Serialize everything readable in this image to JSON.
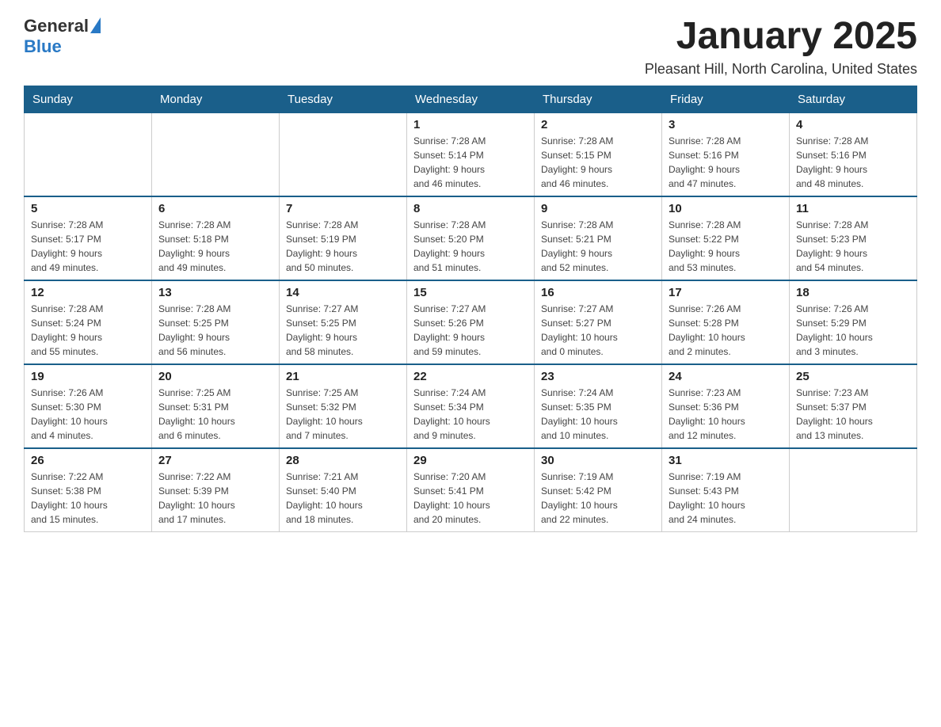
{
  "header": {
    "logo_general": "General",
    "logo_blue": "Blue",
    "month_title": "January 2025",
    "location": "Pleasant Hill, North Carolina, United States"
  },
  "days_of_week": [
    "Sunday",
    "Monday",
    "Tuesday",
    "Wednesday",
    "Thursday",
    "Friday",
    "Saturday"
  ],
  "weeks": [
    [
      {
        "day": "",
        "info": ""
      },
      {
        "day": "",
        "info": ""
      },
      {
        "day": "",
        "info": ""
      },
      {
        "day": "1",
        "info": "Sunrise: 7:28 AM\nSunset: 5:14 PM\nDaylight: 9 hours\nand 46 minutes."
      },
      {
        "day": "2",
        "info": "Sunrise: 7:28 AM\nSunset: 5:15 PM\nDaylight: 9 hours\nand 46 minutes."
      },
      {
        "day": "3",
        "info": "Sunrise: 7:28 AM\nSunset: 5:16 PM\nDaylight: 9 hours\nand 47 minutes."
      },
      {
        "day": "4",
        "info": "Sunrise: 7:28 AM\nSunset: 5:16 PM\nDaylight: 9 hours\nand 48 minutes."
      }
    ],
    [
      {
        "day": "5",
        "info": "Sunrise: 7:28 AM\nSunset: 5:17 PM\nDaylight: 9 hours\nand 49 minutes."
      },
      {
        "day": "6",
        "info": "Sunrise: 7:28 AM\nSunset: 5:18 PM\nDaylight: 9 hours\nand 49 minutes."
      },
      {
        "day": "7",
        "info": "Sunrise: 7:28 AM\nSunset: 5:19 PM\nDaylight: 9 hours\nand 50 minutes."
      },
      {
        "day": "8",
        "info": "Sunrise: 7:28 AM\nSunset: 5:20 PM\nDaylight: 9 hours\nand 51 minutes."
      },
      {
        "day": "9",
        "info": "Sunrise: 7:28 AM\nSunset: 5:21 PM\nDaylight: 9 hours\nand 52 minutes."
      },
      {
        "day": "10",
        "info": "Sunrise: 7:28 AM\nSunset: 5:22 PM\nDaylight: 9 hours\nand 53 minutes."
      },
      {
        "day": "11",
        "info": "Sunrise: 7:28 AM\nSunset: 5:23 PM\nDaylight: 9 hours\nand 54 minutes."
      }
    ],
    [
      {
        "day": "12",
        "info": "Sunrise: 7:28 AM\nSunset: 5:24 PM\nDaylight: 9 hours\nand 55 minutes."
      },
      {
        "day": "13",
        "info": "Sunrise: 7:28 AM\nSunset: 5:25 PM\nDaylight: 9 hours\nand 56 minutes."
      },
      {
        "day": "14",
        "info": "Sunrise: 7:27 AM\nSunset: 5:25 PM\nDaylight: 9 hours\nand 58 minutes."
      },
      {
        "day": "15",
        "info": "Sunrise: 7:27 AM\nSunset: 5:26 PM\nDaylight: 9 hours\nand 59 minutes."
      },
      {
        "day": "16",
        "info": "Sunrise: 7:27 AM\nSunset: 5:27 PM\nDaylight: 10 hours\nand 0 minutes."
      },
      {
        "day": "17",
        "info": "Sunrise: 7:26 AM\nSunset: 5:28 PM\nDaylight: 10 hours\nand 2 minutes."
      },
      {
        "day": "18",
        "info": "Sunrise: 7:26 AM\nSunset: 5:29 PM\nDaylight: 10 hours\nand 3 minutes."
      }
    ],
    [
      {
        "day": "19",
        "info": "Sunrise: 7:26 AM\nSunset: 5:30 PM\nDaylight: 10 hours\nand 4 minutes."
      },
      {
        "day": "20",
        "info": "Sunrise: 7:25 AM\nSunset: 5:31 PM\nDaylight: 10 hours\nand 6 minutes."
      },
      {
        "day": "21",
        "info": "Sunrise: 7:25 AM\nSunset: 5:32 PM\nDaylight: 10 hours\nand 7 minutes."
      },
      {
        "day": "22",
        "info": "Sunrise: 7:24 AM\nSunset: 5:34 PM\nDaylight: 10 hours\nand 9 minutes."
      },
      {
        "day": "23",
        "info": "Sunrise: 7:24 AM\nSunset: 5:35 PM\nDaylight: 10 hours\nand 10 minutes."
      },
      {
        "day": "24",
        "info": "Sunrise: 7:23 AM\nSunset: 5:36 PM\nDaylight: 10 hours\nand 12 minutes."
      },
      {
        "day": "25",
        "info": "Sunrise: 7:23 AM\nSunset: 5:37 PM\nDaylight: 10 hours\nand 13 minutes."
      }
    ],
    [
      {
        "day": "26",
        "info": "Sunrise: 7:22 AM\nSunset: 5:38 PM\nDaylight: 10 hours\nand 15 minutes."
      },
      {
        "day": "27",
        "info": "Sunrise: 7:22 AM\nSunset: 5:39 PM\nDaylight: 10 hours\nand 17 minutes."
      },
      {
        "day": "28",
        "info": "Sunrise: 7:21 AM\nSunset: 5:40 PM\nDaylight: 10 hours\nand 18 minutes."
      },
      {
        "day": "29",
        "info": "Sunrise: 7:20 AM\nSunset: 5:41 PM\nDaylight: 10 hours\nand 20 minutes."
      },
      {
        "day": "30",
        "info": "Sunrise: 7:19 AM\nSunset: 5:42 PM\nDaylight: 10 hours\nand 22 minutes."
      },
      {
        "day": "31",
        "info": "Sunrise: 7:19 AM\nSunset: 5:43 PM\nDaylight: 10 hours\nand 24 minutes."
      },
      {
        "day": "",
        "info": ""
      }
    ]
  ]
}
